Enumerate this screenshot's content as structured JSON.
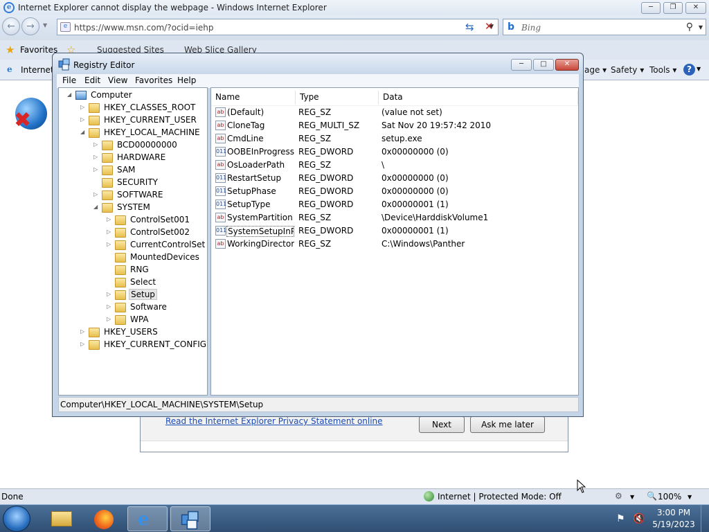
{
  "ie_window": {
    "title": "Internet Explorer cannot display the webpage - Windows Internet Explorer",
    "address": "https://www.msn.com/?ocid=iehp",
    "search_placeholder": "Bing",
    "favorites_label": "Favorites",
    "fav_links": [
      "Suggested Sites",
      "Web Slice Gallery"
    ],
    "tab_label": "Internet",
    "commands": [
      "age",
      "Safety",
      "Tools"
    ],
    "status_left": "Done",
    "zone": "Internet | Protected Mode: Off",
    "zoom": "100%"
  },
  "dialog": {
    "privacy_link": "Read the Internet Explorer Privacy Statement online",
    "next_button": "Next",
    "later_button": "Ask me later"
  },
  "registry": {
    "title": "Registry Editor",
    "menu": [
      "File",
      "Edit",
      "View",
      "Favorites",
      "Help"
    ],
    "tree": [
      {
        "label": "Computer",
        "depth": 0,
        "expander": "expanded",
        "icon": "computer"
      },
      {
        "label": "HKEY_CLASSES_ROOT",
        "depth": 1,
        "expander": "collapsed"
      },
      {
        "label": "HKEY_CURRENT_USER",
        "depth": 1,
        "expander": "collapsed"
      },
      {
        "label": "HKEY_LOCAL_MACHINE",
        "depth": 1,
        "expander": "expanded"
      },
      {
        "label": "BCD00000000",
        "depth": 2,
        "expander": "collapsed"
      },
      {
        "label": "HARDWARE",
        "depth": 2,
        "expander": "collapsed"
      },
      {
        "label": "SAM",
        "depth": 2,
        "expander": "collapsed"
      },
      {
        "label": "SECURITY",
        "depth": 2,
        "expander": "none"
      },
      {
        "label": "SOFTWARE",
        "depth": 2,
        "expander": "collapsed"
      },
      {
        "label": "SYSTEM",
        "depth": 2,
        "expander": "expanded"
      },
      {
        "label": "ControlSet001",
        "depth": 3,
        "expander": "collapsed"
      },
      {
        "label": "ControlSet002",
        "depth": 3,
        "expander": "collapsed"
      },
      {
        "label": "CurrentControlSet",
        "depth": 3,
        "expander": "collapsed"
      },
      {
        "label": "MountedDevices",
        "depth": 3,
        "expander": "none"
      },
      {
        "label": "RNG",
        "depth": 3,
        "expander": "none"
      },
      {
        "label": "Select",
        "depth": 3,
        "expander": "none"
      },
      {
        "label": "Setup",
        "depth": 3,
        "expander": "collapsed",
        "selected": true
      },
      {
        "label": "Software",
        "depth": 3,
        "expander": "collapsed"
      },
      {
        "label": "WPA",
        "depth": 3,
        "expander": "collapsed"
      },
      {
        "label": "HKEY_USERS",
        "depth": 1,
        "expander": "collapsed"
      },
      {
        "label": "HKEY_CURRENT_CONFIG",
        "depth": 1,
        "expander": "collapsed"
      }
    ],
    "list": {
      "columns": [
        "Name",
        "Type",
        "Data"
      ],
      "rows": [
        {
          "icon": "string",
          "name": "(Default)",
          "type": "REG_SZ",
          "data": "(value not set)"
        },
        {
          "icon": "string",
          "name": "CloneTag",
          "type": "REG_MULTI_SZ",
          "data": "Sat Nov 20 19:57:42 2010"
        },
        {
          "icon": "string",
          "name": "CmdLine",
          "type": "REG_SZ",
          "data": "setup.exe"
        },
        {
          "icon": "dword",
          "name": "OOBEInProgress",
          "type": "REG_DWORD",
          "data": "0x00000000 (0)"
        },
        {
          "icon": "string",
          "name": "OsLoaderPath",
          "type": "REG_SZ",
          "data": "\\"
        },
        {
          "icon": "dword",
          "name": "RestartSetup",
          "type": "REG_DWORD",
          "data": "0x00000000 (0)"
        },
        {
          "icon": "dword",
          "name": "SetupPhase",
          "type": "REG_DWORD",
          "data": "0x00000000 (0)"
        },
        {
          "icon": "dword",
          "name": "SetupType",
          "type": "REG_DWORD",
          "data": "0x00000001 (1)"
        },
        {
          "icon": "string",
          "name": "SystemPartition",
          "type": "REG_SZ",
          "data": "\\Device\\HarddiskVolume1"
        },
        {
          "icon": "dword",
          "name": "SystemSetupInP...",
          "type": "REG_DWORD",
          "data": "0x00000001 (1)",
          "focused": true
        },
        {
          "icon": "string",
          "name": "WorkingDirectory",
          "type": "REG_SZ",
          "data": "C:\\Windows\\Panther"
        }
      ]
    },
    "status_path": "Computer\\HKEY_LOCAL_MACHINE\\SYSTEM\\Setup"
  },
  "taskbar": {
    "items": [
      "start-orb",
      "explorer",
      "firefox",
      "internet-explorer",
      "registry-editor"
    ],
    "time": "3:00 PM",
    "date": "5/19/2023"
  }
}
